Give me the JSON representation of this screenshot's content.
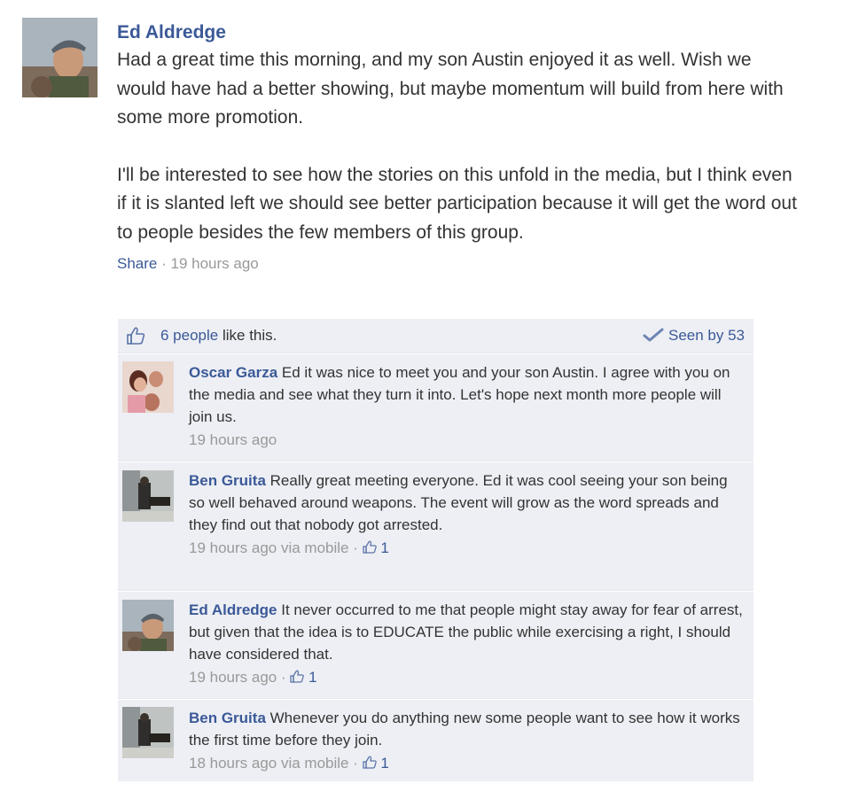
{
  "post": {
    "author": "Ed Aldredge",
    "paragraphs": [
      "Had a great time this morning, and my son Austin enjoyed it as well. Wish we would have had a better showing, but maybe momentum will build from here with some more promotion.",
      "I'll be interested to see how the stories on this unfold in the media, but I think even if it is slanted left we should see better participation because it will get the word out to people besides the few members of this group."
    ],
    "share_label": "Share",
    "separator": " · ",
    "time": "19 hours ago"
  },
  "likes": {
    "people_link": "6 people",
    "suffix": " like this.",
    "seen_label": "Seen by 53",
    "colors": {
      "link": "#3b5998",
      "panel": "#edeff4"
    }
  },
  "comments": [
    {
      "author": "Oscar Garza",
      "text": " Ed it was nice to meet you and your son Austin. I agree with you on the media and see what they turn it into. Let's hope next month more people will join us.",
      "meta": "19 hours ago",
      "likes": ""
    },
    {
      "author": "Ben Gruita",
      "text": " Really great meeting everyone. Ed it was cool seeing your son being so well behaved around weapons. The event will grow as the word spreads and they find out that nobody got arrested.",
      "meta": "19 hours ago via mobile · ",
      "likes": "1"
    },
    {
      "author": "Ed Aldredge",
      "text": " It never occurred to me that people might stay away for fear of arrest, but given that the idea is to EDUCATE the public while exercising a right, I should have considered that.",
      "meta": "19 hours ago · ",
      "likes": "1"
    },
    {
      "author": "Ben Gruita",
      "text": " Whenever you do anything new some people want to see how it works the first time before they join.",
      "meta": "18 hours ago via mobile · ",
      "likes": "1"
    }
  ],
  "icons": {
    "like": "thumbs-up-icon",
    "seen": "check-icon"
  }
}
